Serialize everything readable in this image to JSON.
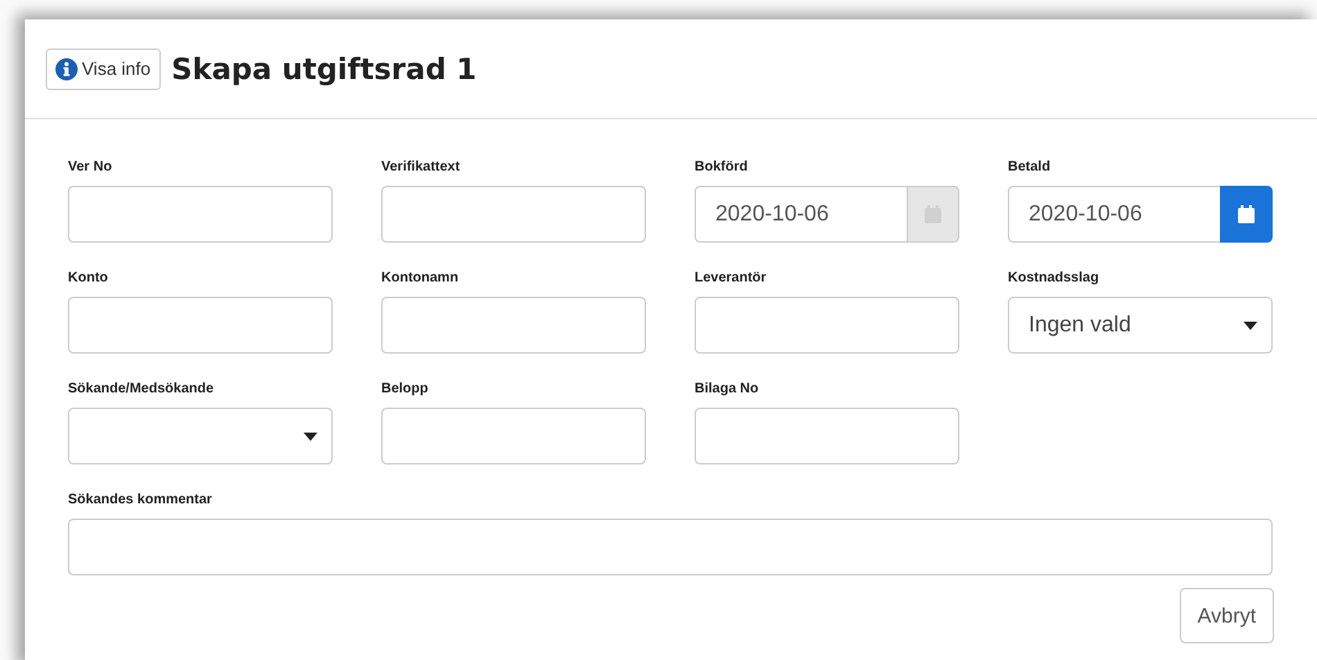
{
  "header": {
    "info_button": "Visa info",
    "title": "Skapa utgiftsrad 1"
  },
  "fields": [
    {
      "kind": "text",
      "label": "Ver No"
    },
    {
      "kind": "text",
      "label": "Verifikattext"
    },
    {
      "kind": "date",
      "label": "Bokförd",
      "value": "2020-10-06",
      "picker_disabled": true
    },
    {
      "kind": "date",
      "label": "Betald",
      "value": "2020-10-06",
      "picker_disabled": false
    },
    {
      "kind": "text",
      "label": "Konto"
    },
    {
      "kind": "text",
      "label": "Kontonamn"
    },
    {
      "kind": "text",
      "label": "Leverantör"
    },
    {
      "kind": "select",
      "label": "Kostnadsslag",
      "value": "Ingen vald"
    },
    {
      "kind": "select",
      "label": "Sökande/Medsökande"
    },
    {
      "kind": "text",
      "label": "Belopp"
    },
    {
      "kind": "text",
      "label": "Bilaga No"
    },
    {
      "kind": "wide",
      "label": "Sökandes kommentar"
    }
  ],
  "cancel_button": "Avbryt"
}
